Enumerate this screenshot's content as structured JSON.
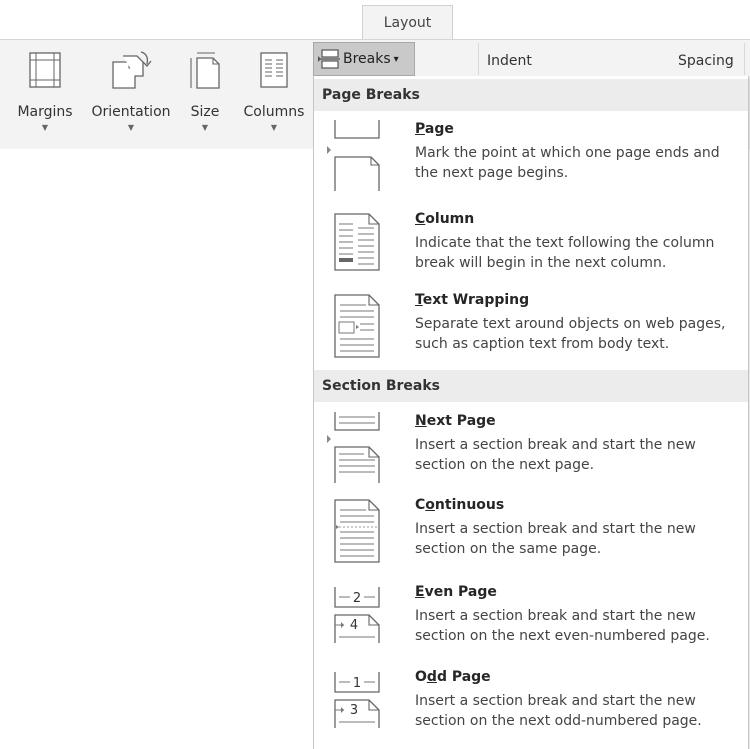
{
  "ribbon": {
    "tab_label": "Layout",
    "buttons": [
      {
        "label": "Margins",
        "icon": "margins-icon"
      },
      {
        "label": "Orientation",
        "icon": "orientation-icon"
      },
      {
        "label": "Size",
        "icon": "size-icon"
      },
      {
        "label": "Columns",
        "icon": "columns-icon"
      }
    ],
    "breaks_label": "Breaks",
    "breaks_arrow": "▾",
    "dropdown_arrow": "▼",
    "indent_label": "Indent",
    "spacing_label": "Spacing"
  },
  "menu": {
    "page_breaks_header": "Page Breaks",
    "section_breaks_header": "Section Breaks",
    "page_breaks": [
      {
        "accel": "P",
        "rest": "age",
        "desc": "Mark the point at which one page ends and the next page begins.",
        "icon": "page-break-icon"
      },
      {
        "accel": "C",
        "rest": "olumn",
        "desc": "Indicate that the text following the column break will begin in the next column.",
        "icon": "column-break-icon"
      },
      {
        "accel": "T",
        "rest": "ext Wrapping",
        "desc": "Separate text around objects on web pages, such as caption text from body text.",
        "icon": "text-wrapping-icon"
      }
    ],
    "section_breaks": [
      {
        "pre": "",
        "accel": "N",
        "rest": "ext Page",
        "desc": "Insert a section break and start the new section on the next page.",
        "icon": "next-page-icon"
      },
      {
        "pre": "C",
        "accel": "o",
        "rest": "ntinuous",
        "desc": "Insert a section break and start the new section on the same page.",
        "icon": "continuous-icon"
      },
      {
        "pre": "",
        "accel": "E",
        "rest": "ven Page",
        "desc": "Insert a section break and start the new section on the next even-numbered page.",
        "icon": "even-page-icon",
        "num_top": "2",
        "num_bottom": "4"
      },
      {
        "pre": "O",
        "accel": "d",
        "rest": "d Page",
        "desc": "Insert a section break and start the new section on the next odd-numbered page.",
        "icon": "odd-page-icon",
        "num_top": "1",
        "num_bottom": "3"
      }
    ]
  },
  "colors": {
    "ribbon_bg": "#f3f3f3",
    "header_bg": "#ececec",
    "breaks_selected": "#c9c9c9"
  }
}
